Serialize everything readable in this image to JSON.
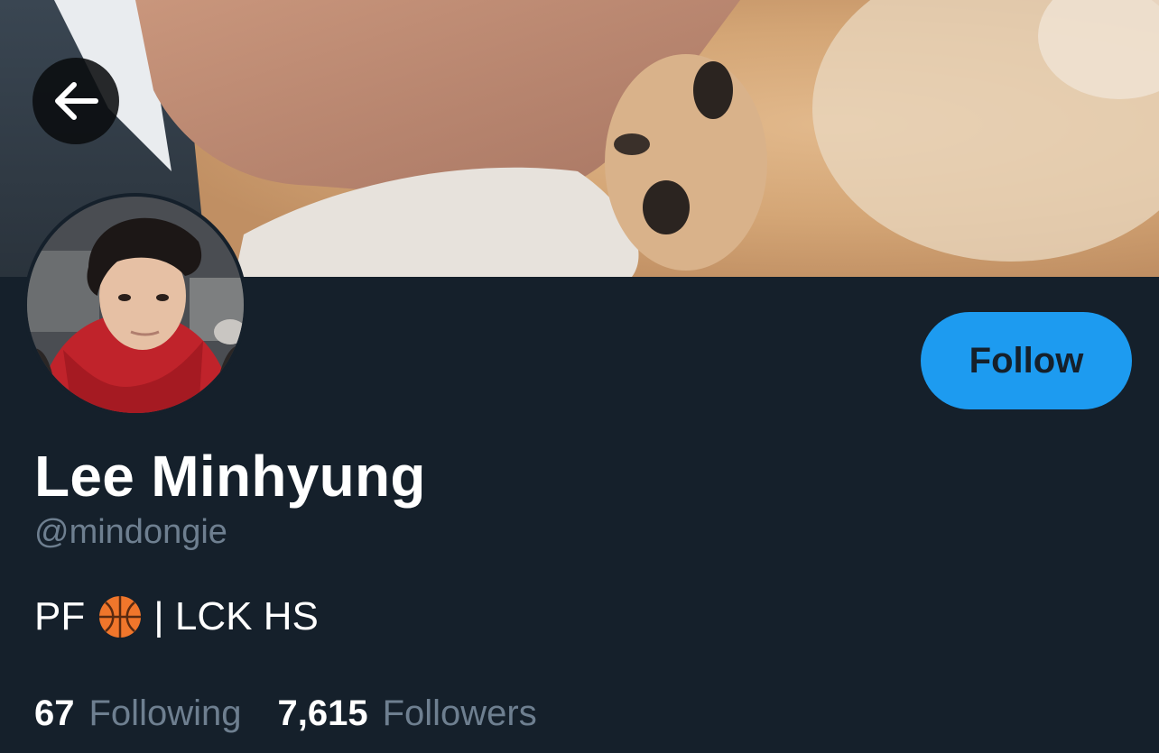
{
  "profile": {
    "display_name": "Lee Minhyung",
    "handle": "@mindongie",
    "bio_prefix": "PF",
    "bio_emoji": "basketball-emoji",
    "bio_suffix": "| LCK HS"
  },
  "actions": {
    "follow_label": "Follow",
    "back_icon": "arrow-left-icon"
  },
  "stats": {
    "following_count": "67",
    "following_label": "Following",
    "followers_count": "7,615",
    "followers_label": "Followers"
  },
  "colors": {
    "background": "#15202b",
    "accent": "#1d9bf0",
    "muted_text": "#6e7f90",
    "primary_text": "#ffffff"
  }
}
